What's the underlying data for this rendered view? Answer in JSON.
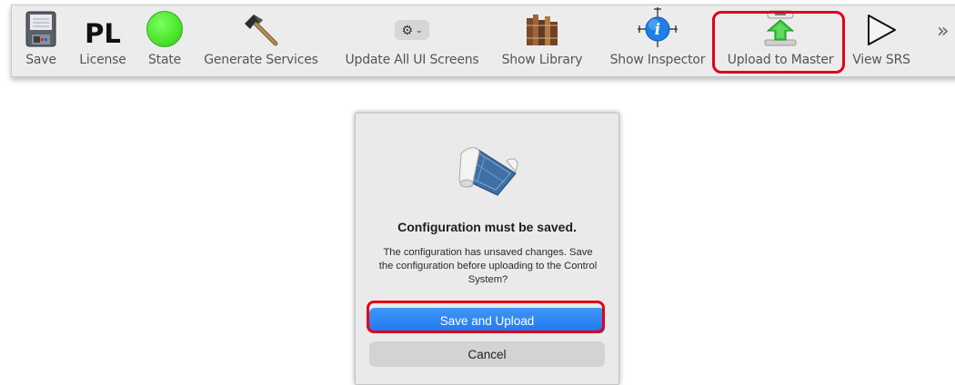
{
  "toolbar": {
    "items": [
      {
        "label": "Save",
        "icon": "floppy-disk-icon"
      },
      {
        "label": "License",
        "icon_text": "PL"
      },
      {
        "label": "State",
        "icon": "green-status-dot-icon",
        "color": "#4ee62e"
      },
      {
        "label": "Generate Services",
        "icon": "hammer-icon"
      },
      {
        "label": "Update All UI Screens",
        "icon": "gear-dropdown-icon"
      },
      {
        "label": "Show Library",
        "icon": "books-icon"
      },
      {
        "label": "Show Inspector",
        "icon": "info-inspector-icon"
      },
      {
        "label": "Upload to Master",
        "icon": "upload-arrow-icon",
        "highlighted": true
      },
      {
        "label": "View SRS",
        "icon": "play-triangle-icon"
      }
    ],
    "overflow_glyph": "»",
    "highlight_color": "#e0001b"
  },
  "dialog": {
    "icon": "blueprint-scroll-icon",
    "title": "Configuration must be saved.",
    "message": "The configuration has unsaved changes. Save the configuration before uploading to the Control System?",
    "primary_button": "Save and Upload",
    "secondary_button": "Cancel",
    "primary_color": "#2a84f3"
  }
}
